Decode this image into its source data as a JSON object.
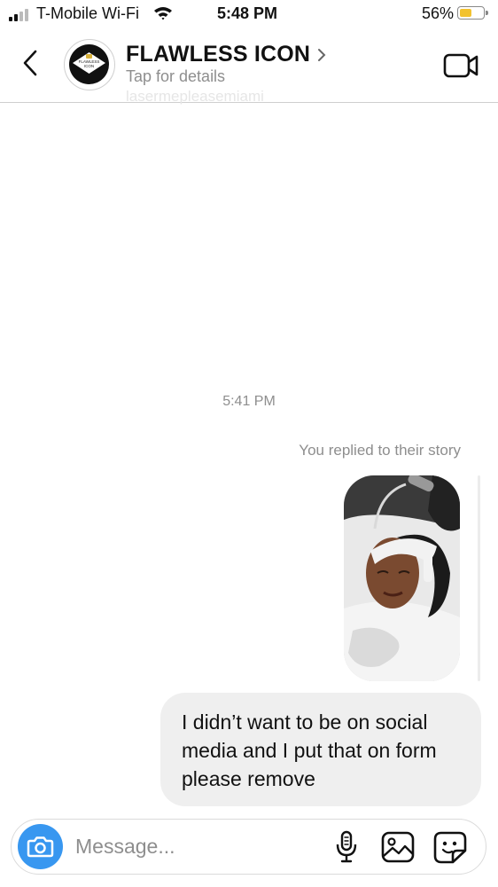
{
  "status_bar": {
    "carrier": "T-Mobile Wi-Fi",
    "time": "5:48 PM",
    "battery_percent": "56%",
    "battery_level": 0.56,
    "signal_bars": 2
  },
  "header": {
    "title": "FLAWLESS ICON",
    "subtitle": "Tap for details",
    "handle": "lasermepleasemiami",
    "avatar_text": "FLAWLESS ICON",
    "icons": {
      "back": "chevron-left-icon",
      "details": "chevron-right-icon",
      "video": "video-call-icon"
    }
  },
  "chat": {
    "timestamp": "5:41 PM",
    "reply_label": "You replied to their story",
    "story_thumbnail": "story-photo",
    "message": "I didn’t want to be on social media and I put that on form please remove"
  },
  "composer": {
    "placeholder": "Message...",
    "value": "",
    "icons": {
      "camera": "camera-icon",
      "mic": "microphone-icon",
      "gallery": "gallery-icon",
      "sticker": "sticker-icon"
    }
  },
  "colors": {
    "accent": "#3897f0",
    "bubble": "#efefef",
    "muted": "#8e8e8e",
    "battery": "#f2c230"
  }
}
